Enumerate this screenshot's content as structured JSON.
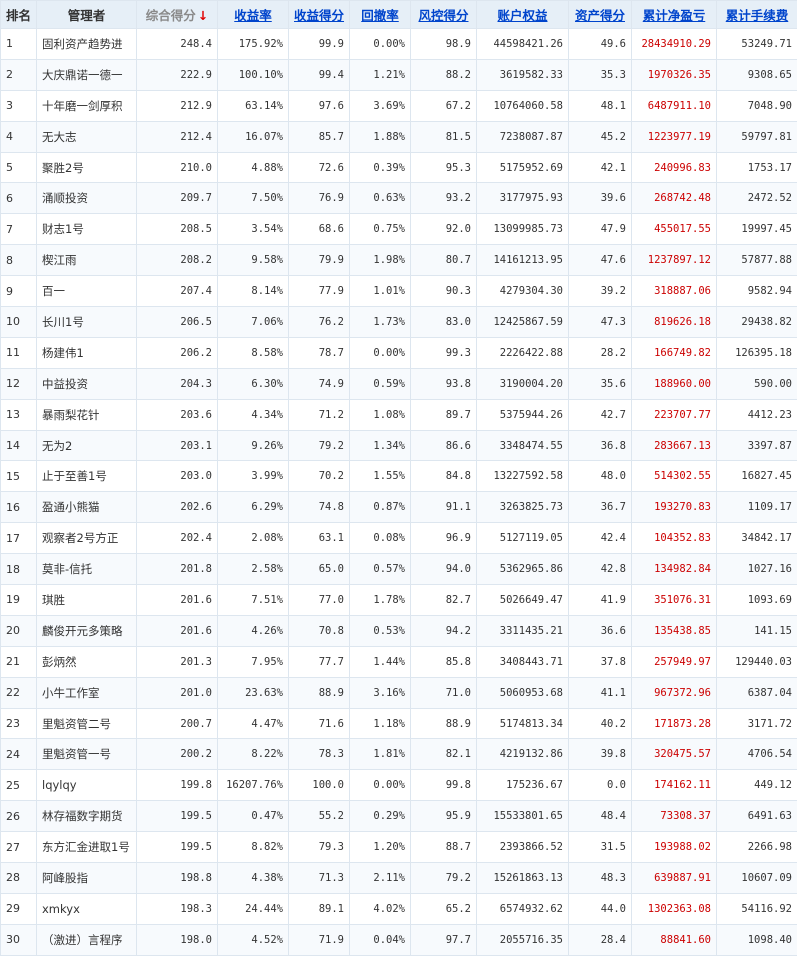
{
  "headers": {
    "rank": "排名",
    "manager": "管理者",
    "total_score": "综合得分",
    "sort_arrow": "↓",
    "return_rate": "收益率",
    "return_score": "收益得分",
    "drawdown": "回撤率",
    "risk_score": "风控得分",
    "equity": "账户权益",
    "asset_score": "资产得分",
    "net_pnl": "累计净盈亏",
    "fees": "累计手续费"
  },
  "colors": {
    "header_bg": "#e6eff7",
    "link": "#0044cc",
    "pnl_red": "#cc0000",
    "sort_arrow": "#e00000"
  },
  "rows": [
    [
      "1",
      "固利资产趋势进",
      "248.4",
      "175.92%",
      "99.9",
      "0.00%",
      "98.9",
      "44598421.26",
      "49.6",
      "28434910.29",
      "53249.71"
    ],
    [
      "2",
      "大庆鼎诺一德一",
      "222.9",
      "100.10%",
      "99.4",
      "1.21%",
      "88.2",
      "3619582.33",
      "35.3",
      "1970326.35",
      "9308.65"
    ],
    [
      "3",
      "十年磨一剑厚积",
      "212.9",
      "63.14%",
      "97.6",
      "3.69%",
      "67.2",
      "10764060.58",
      "48.1",
      "6487911.10",
      "7048.90"
    ],
    [
      "4",
      "无大志",
      "212.4",
      "16.07%",
      "85.7",
      "1.88%",
      "81.5",
      "7238087.87",
      "45.2",
      "1223977.19",
      "59797.81"
    ],
    [
      "5",
      "聚胜2号",
      "210.0",
      "4.88%",
      "72.6",
      "0.39%",
      "95.3",
      "5175952.69",
      "42.1",
      "240996.83",
      "1753.17"
    ],
    [
      "6",
      "涌顺投资",
      "209.7",
      "7.50%",
      "76.9",
      "0.63%",
      "93.2",
      "3177975.93",
      "39.6",
      "268742.48",
      "2472.52"
    ],
    [
      "7",
      "财志1号",
      "208.5",
      "3.54%",
      "68.6",
      "0.75%",
      "92.0",
      "13099985.73",
      "47.9",
      "455017.55",
      "19997.45"
    ],
    [
      "8",
      "楔江雨",
      "208.2",
      "9.58%",
      "79.9",
      "1.98%",
      "80.7",
      "14161213.95",
      "47.6",
      "1237897.12",
      "57877.88"
    ],
    [
      "9",
      "百一",
      "207.4",
      "8.14%",
      "77.9",
      "1.01%",
      "90.3",
      "4279304.30",
      "39.2",
      "318887.06",
      "9582.94"
    ],
    [
      "10",
      "长川1号",
      "206.5",
      "7.06%",
      "76.2",
      "1.73%",
      "83.0",
      "12425867.59",
      "47.3",
      "819626.18",
      "29438.82"
    ],
    [
      "11",
      "杨建伟1",
      "206.2",
      "8.58%",
      "78.7",
      "0.00%",
      "99.3",
      "2226422.88",
      "28.2",
      "166749.82",
      "126395.18"
    ],
    [
      "12",
      "中益投资",
      "204.3",
      "6.30%",
      "74.9",
      "0.59%",
      "93.8",
      "3190004.20",
      "35.6",
      "188960.00",
      "590.00"
    ],
    [
      "13",
      "暴雨梨花针",
      "203.6",
      "4.34%",
      "71.2",
      "1.08%",
      "89.7",
      "5375944.26",
      "42.7",
      "223707.77",
      "4412.23"
    ],
    [
      "14",
      "无为2",
      "203.1",
      "9.26%",
      "79.2",
      "1.34%",
      "86.6",
      "3348474.55",
      "36.8",
      "283667.13",
      "3397.87"
    ],
    [
      "15",
      "止于至善1号",
      "203.0",
      "3.99%",
      "70.2",
      "1.55%",
      "84.8",
      "13227592.58",
      "48.0",
      "514302.55",
      "16827.45"
    ],
    [
      "16",
      "盈通小熊猫",
      "202.6",
      "6.29%",
      "74.8",
      "0.87%",
      "91.1",
      "3263825.73",
      "36.7",
      "193270.83",
      "1109.17"
    ],
    [
      "17",
      "观察者2号方正",
      "202.4",
      "2.08%",
      "63.1",
      "0.08%",
      "96.9",
      "5127119.05",
      "42.4",
      "104352.83",
      "34842.17"
    ],
    [
      "18",
      "莫非-信托",
      "201.8",
      "2.58%",
      "65.0",
      "0.57%",
      "94.0",
      "5362965.86",
      "42.8",
      "134982.84",
      "1027.16"
    ],
    [
      "19",
      "琪胜",
      "201.6",
      "7.51%",
      "77.0",
      "1.78%",
      "82.7",
      "5026649.47",
      "41.9",
      "351076.31",
      "1093.69"
    ],
    [
      "20",
      "麟俊开元多策略",
      "201.6",
      "4.26%",
      "70.8",
      "0.53%",
      "94.2",
      "3311435.21",
      "36.6",
      "135438.85",
      "141.15"
    ],
    [
      "21",
      "彭炳然",
      "201.3",
      "7.95%",
      "77.7",
      "1.44%",
      "85.8",
      "3408443.71",
      "37.8",
      "257949.97",
      "129440.03"
    ],
    [
      "22",
      "小牛工作室",
      "201.0",
      "23.63%",
      "88.9",
      "3.16%",
      "71.0",
      "5060953.68",
      "41.1",
      "967372.96",
      "6387.04"
    ],
    [
      "23",
      "里魁资管二号",
      "200.7",
      "4.47%",
      "71.6",
      "1.18%",
      "88.9",
      "5174813.34",
      "40.2",
      "171873.28",
      "3171.72"
    ],
    [
      "24",
      "里魁资管一号",
      "200.2",
      "8.22%",
      "78.3",
      "1.81%",
      "82.1",
      "4219132.86",
      "39.8",
      "320475.57",
      "4706.54"
    ],
    [
      "25",
      "lqylqy",
      "199.8",
      "16207.76%",
      "100.0",
      "0.00%",
      "99.8",
      "175236.67",
      "0.0",
      "174162.11",
      "449.12"
    ],
    [
      "26",
      "林存福数字期货",
      "199.5",
      "0.47%",
      "55.2",
      "0.29%",
      "95.9",
      "15533801.65",
      "48.4",
      "73308.37",
      "6491.63"
    ],
    [
      "27",
      "东方汇金进取1号",
      "199.5",
      "8.82%",
      "79.3",
      "1.20%",
      "88.7",
      "2393866.52",
      "31.5",
      "193988.02",
      "2266.98"
    ],
    [
      "28",
      "阿峰股指",
      "198.8",
      "4.38%",
      "71.3",
      "2.11%",
      "79.2",
      "15261863.13",
      "48.3",
      "639887.91",
      "10607.09"
    ],
    [
      "29",
      "xmkyx",
      "198.3",
      "24.44%",
      "89.1",
      "4.02%",
      "65.2",
      "6574932.62",
      "44.0",
      "1302363.08",
      "54116.92"
    ],
    [
      "30",
      "（激进）言程序",
      "198.0",
      "4.52%",
      "71.9",
      "0.04%",
      "97.7",
      "2055716.35",
      "28.4",
      "88841.60",
      "1098.40"
    ]
  ]
}
